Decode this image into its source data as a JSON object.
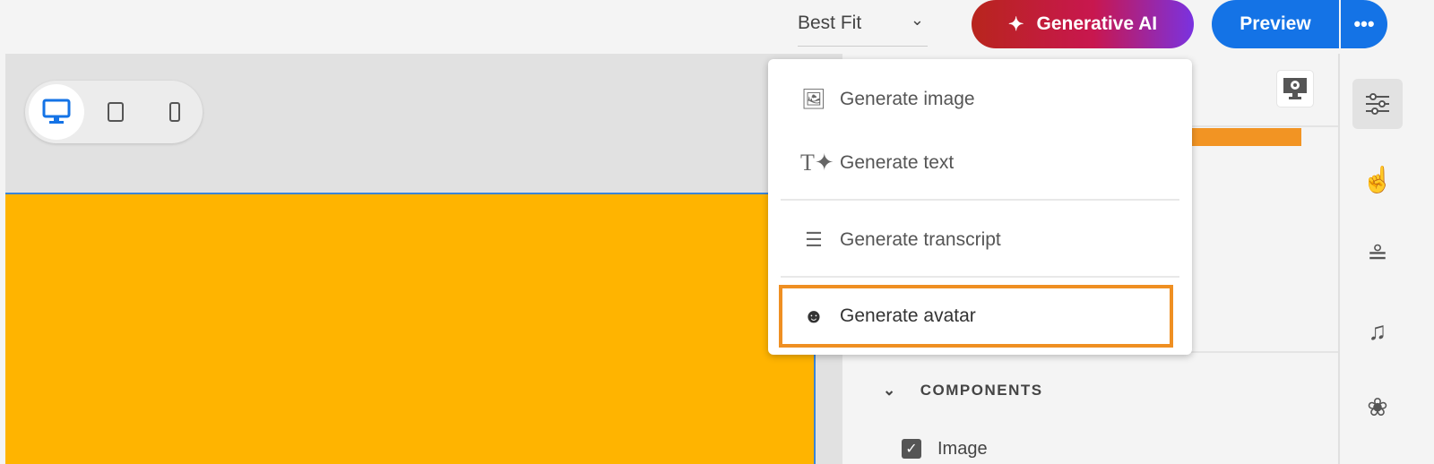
{
  "toolbar": {
    "zoom_value": "Best Fit",
    "generative_ai_label": "Generative AI",
    "preview_label": "Preview",
    "more_label": "•••"
  },
  "ai_menu": {
    "items": [
      {
        "label": "Generate image",
        "icon": "image-sparkle-icon"
      },
      {
        "label": "Generate text",
        "icon": "text-sparkle-icon"
      },
      {
        "label": "Generate transcript",
        "icon": "transcript-sparkle-icon"
      },
      {
        "label": "Generate avatar",
        "icon": "avatar-sparkle-icon",
        "highlighted": true
      }
    ]
  },
  "panel": {
    "section_title": "COMPONENTS",
    "components": [
      {
        "label": "Image",
        "checked": true
      }
    ]
  },
  "colors": {
    "accent": "#1473e6",
    "stage": "#ffb400",
    "highlight": "#ef8f22"
  }
}
